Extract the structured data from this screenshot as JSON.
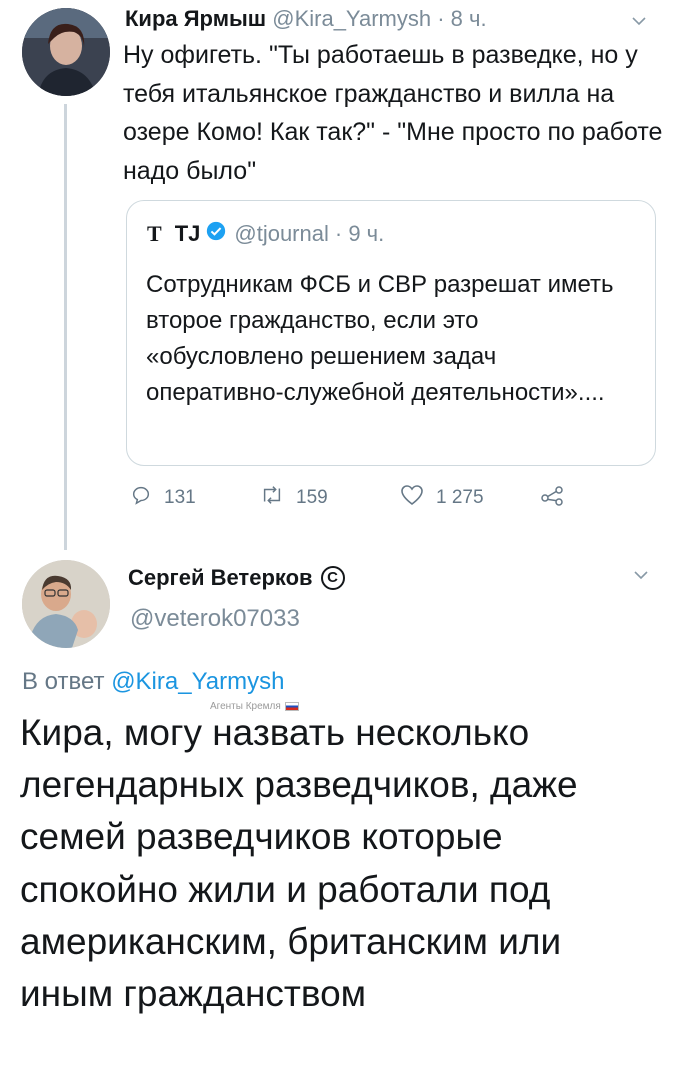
{
  "tweet1": {
    "author_name": "Кира Ярмыш",
    "author_handle": "@Kira_Yarmysh",
    "time": "· 8 ч.",
    "text": "Ну офигеть. \"Ты работаешь в разведке, но у тебя итальянское гражданство и вилла на озере Комо! Как так?\" - \"Мне просто по работе надо было\"",
    "quoted": {
      "logo": "T",
      "author_name": "TJ",
      "author_handle": "@tjournal",
      "time": "· 9 ч.",
      "text": "Сотрудникам ФСБ и СВР разрешат иметь второе гражданство, если это «обусловлено решением задач оперативно-служебной деятельности»....",
      "verified_icon": "verified-badge-icon"
    },
    "actions": {
      "replies": "131",
      "retweets": "159",
      "likes": "1 275"
    }
  },
  "tweet2": {
    "author_name": "Сергей Ветерков",
    "copyright_mark": "C",
    "author_handle": "@veterok07033",
    "reply_prefix": "В ответ",
    "reply_handle": "@Kira_Yarmysh",
    "watermark": "Агенты Кремля",
    "text": "Кира, могу назвать несколько легендарных разведчиков, даже семей разведчиков которые спокойно жили и работали под американским, британским или иным гражданством"
  },
  "colors": {
    "link": "#1b95e0",
    "verified": "#1da1f2",
    "secondary_text": "#657786",
    "thread_line": "#cdd5dc"
  }
}
